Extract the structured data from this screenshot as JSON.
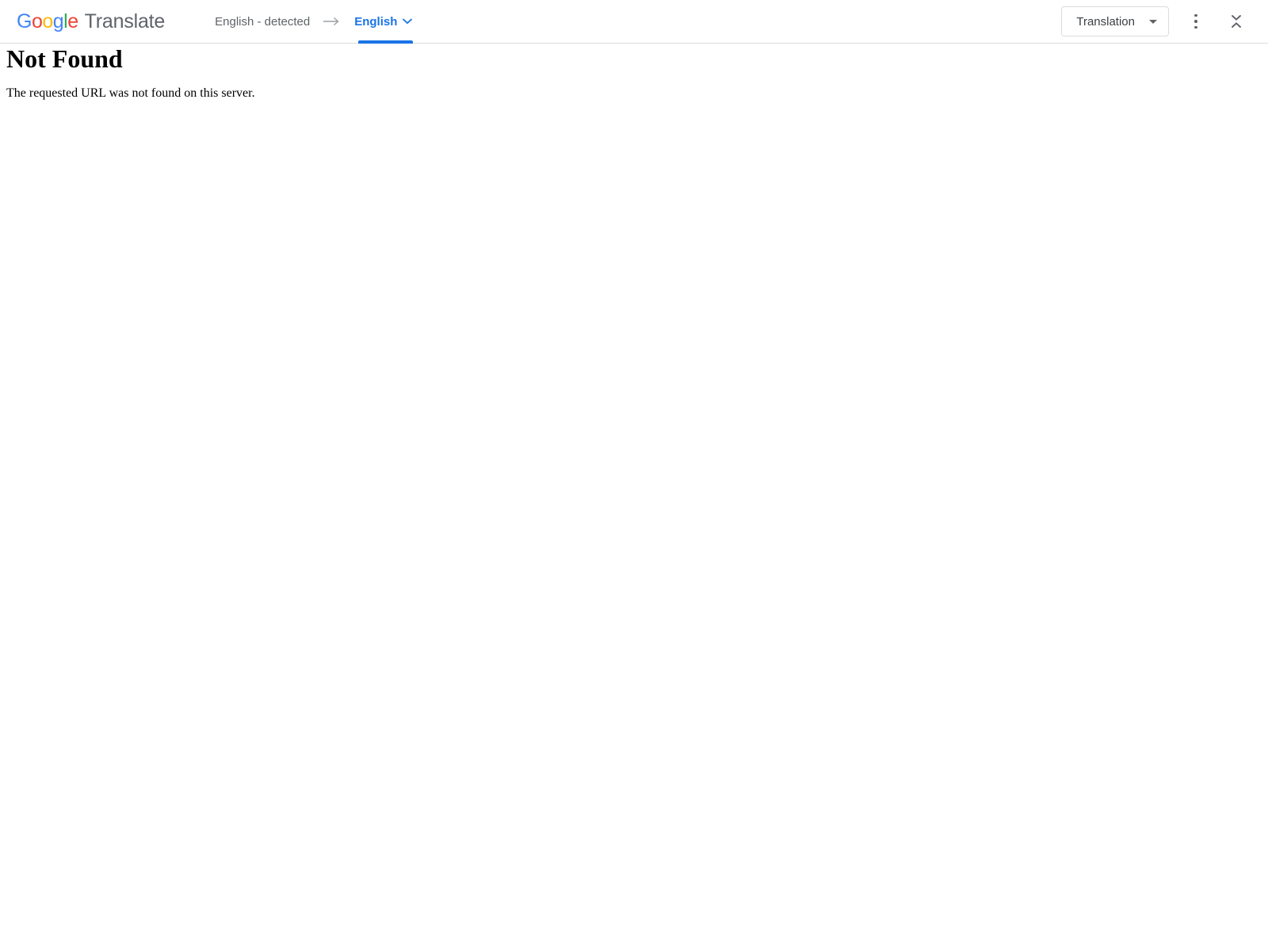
{
  "translate_bar": {
    "brand": {
      "google_letters": [
        {
          "char": "G",
          "color": "#4285f4"
        },
        {
          "char": "o",
          "color": "#ea4335"
        },
        {
          "char": "o",
          "color": "#fbbc05"
        },
        {
          "char": "g",
          "color": "#4285f4"
        },
        {
          "char": "l",
          "color": "#34a853"
        },
        {
          "char": "e",
          "color": "#ea4335"
        }
      ],
      "product_name": "Translate"
    },
    "source_language": "English - detected",
    "direction_arrow": "→",
    "direction_arrow_icon_name": "arrow-right-icon",
    "target_language": "English",
    "target_chevron_icon_name": "chevron-down-icon",
    "active_tab_color": "#1a73e8",
    "mode_button": {
      "label": "Translation",
      "caret_icon_name": "caret-down-icon"
    },
    "more_options_icon_name": "more-vert-icon",
    "collapse_icon_name": "collapse-icon",
    "border_color": "#dadce0"
  },
  "page": {
    "heading": "Not Found",
    "message": "The requested URL was not found on this server."
  }
}
